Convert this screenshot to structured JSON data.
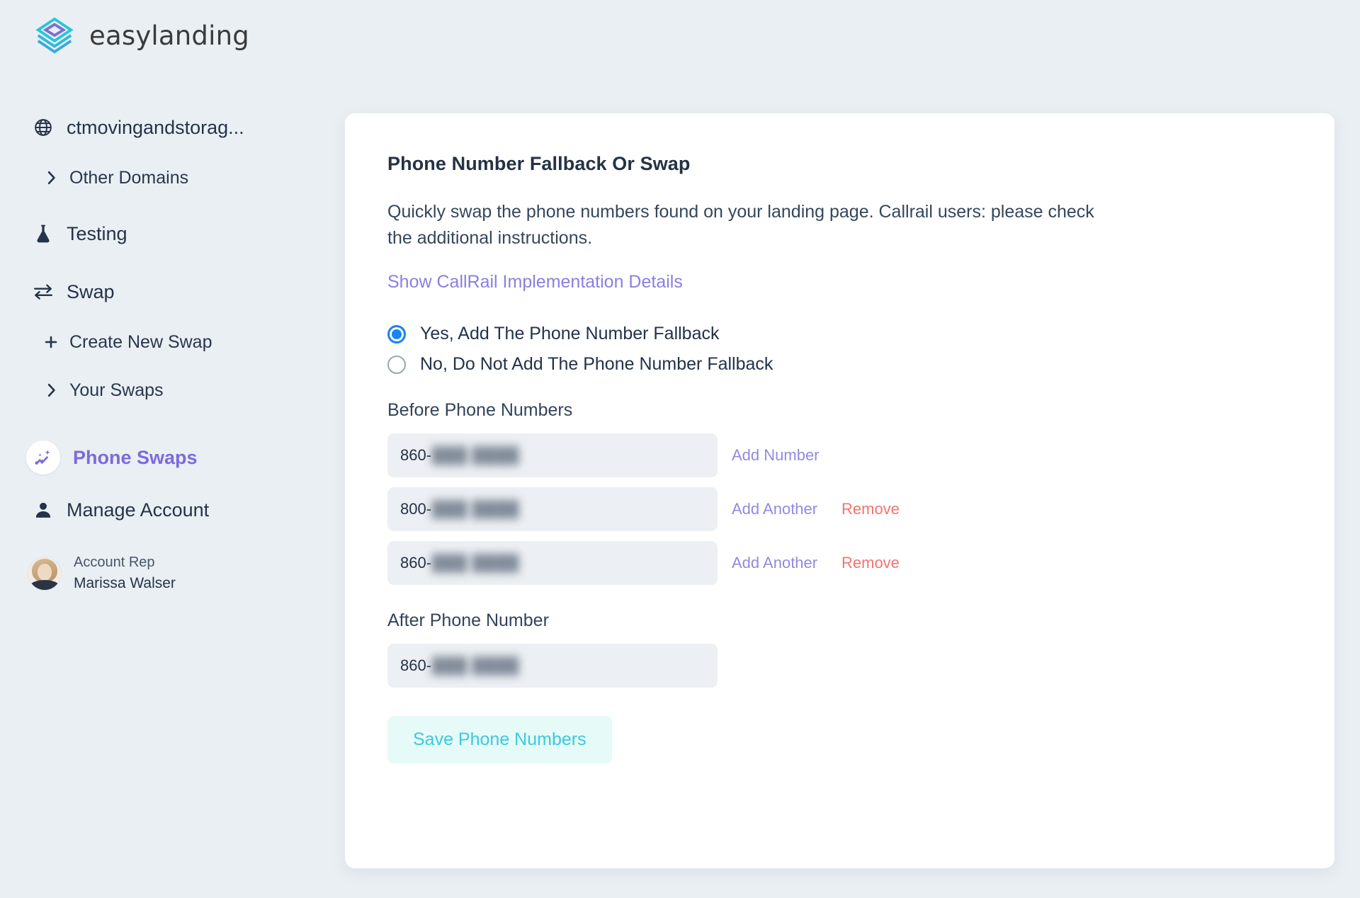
{
  "brand": {
    "name": "easylanding",
    "logo_icon": "layered-diamond-logo"
  },
  "sidebar": {
    "domain": {
      "icon": "globe-icon",
      "label": "ctmovingandstorag..."
    },
    "other_domains": {
      "icon": "chevron-right-icon",
      "label": "Other Domains"
    },
    "testing": {
      "icon": "flask-icon",
      "label": "Testing"
    },
    "swap": {
      "icon": "swap-arrows-icon",
      "label": "Swap"
    },
    "create_new_swap": {
      "icon": "plus-icon",
      "label": "Create New Swap"
    },
    "your_swaps": {
      "icon": "chevron-right-icon",
      "label": "Your Swaps"
    },
    "phone_swaps": {
      "icon": "analytics-sparkle-icon",
      "label": "Phone Swaps",
      "active": true,
      "active_color": "#7c6bdb"
    },
    "manage_account": {
      "icon": "person-icon",
      "label": "Manage Account"
    },
    "account_rep": {
      "avatar_icon": "avatar",
      "role": "Account Rep",
      "name": "Marissa Walser"
    }
  },
  "main": {
    "title": "Phone Number Fallback Or Swap",
    "description": "Quickly swap the phone numbers found on your landing page. Callrail users: please check the additional instructions.",
    "callrail_link": "Show CallRail Implementation Details",
    "radios": [
      {
        "label": "Yes, Add The Phone Number Fallback",
        "checked": true
      },
      {
        "label": "No, Do Not Add The Phone Number Fallback",
        "checked": false
      }
    ],
    "before_label": "Before Phone Numbers",
    "before_numbers": [
      {
        "prefix": "860-",
        "masked": "███ ████",
        "add_label": "Add Number",
        "remove_label": ""
      },
      {
        "prefix": "800-",
        "masked": "███ ████",
        "add_label": "Add Another",
        "remove_label": "Remove"
      },
      {
        "prefix": "860-",
        "masked": "███ ████",
        "add_label": "Add Another",
        "remove_label": "Remove"
      }
    ],
    "after_label": "After Phone Number",
    "after_number": {
      "prefix": "860-",
      "masked": "███ ████"
    },
    "save_button": "Save Phone Numbers"
  },
  "colors": {
    "page_bg": "#eaeff3",
    "card_bg": "#ffffff",
    "accent_purple": "#8a7fe0",
    "accent_cyan": "#3bc9df",
    "danger_red": "#f4736e",
    "radio_blue": "#1a84f0"
  }
}
